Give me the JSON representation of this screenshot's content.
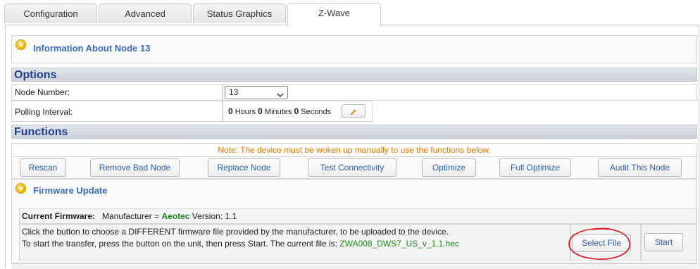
{
  "tabs": [
    {
      "label": "Configuration",
      "active": false
    },
    {
      "label": "Advanced",
      "active": false
    },
    {
      "label": "Status Graphics",
      "active": false
    },
    {
      "label": "Z-Wave",
      "active": true
    }
  ],
  "info_section": {
    "title": "Information About Node 13"
  },
  "options": {
    "header": "Options",
    "node_number_label": "Node Number:",
    "node_number_value": "13",
    "polling_label": "Polling Interval:",
    "polling": {
      "hours": "0",
      "hours_label": "Hours",
      "minutes": "0",
      "minutes_label": "Minutes",
      "seconds": "0",
      "seconds_label": "Seconds"
    }
  },
  "functions": {
    "header": "Functions",
    "note": "Note: The device must be woken up manually to use the functions below.",
    "buttons": [
      "Rescan",
      "Remove Bad Node",
      "Replace Node",
      "Test Connectivity",
      "Optimize",
      "Full Optimize",
      "Audit This Node"
    ]
  },
  "firmware": {
    "title": "Firmware Update",
    "current_label": "Current Firmware:",
    "manufacturer_prefix": "Manufacturer =",
    "manufacturer": "Aeotec",
    "version_text": "Version: 1.1",
    "instruction_line1": "Click the button to choose a DIFFERENT firmware file provided by the manufacturer, to be uploaded to the device.",
    "instruction_line2_prefix": "To start the transfer, press the button on the unit, then press Start. The current file is:",
    "current_file": "ZWA008_DWS7_US_v_1.1.hec",
    "select_file_label": "Select File",
    "start_label": "Start"
  },
  "colors": {
    "link_blue": "#3a6bbf",
    "header_navy": "#1e3f91",
    "note_orange": "#e07a00",
    "green": "#1a8a1a",
    "annotation_red": "#e0101a"
  },
  "icons": [
    "play-circle-icon",
    "chevron-down-icon",
    "pencil-icon"
  ]
}
